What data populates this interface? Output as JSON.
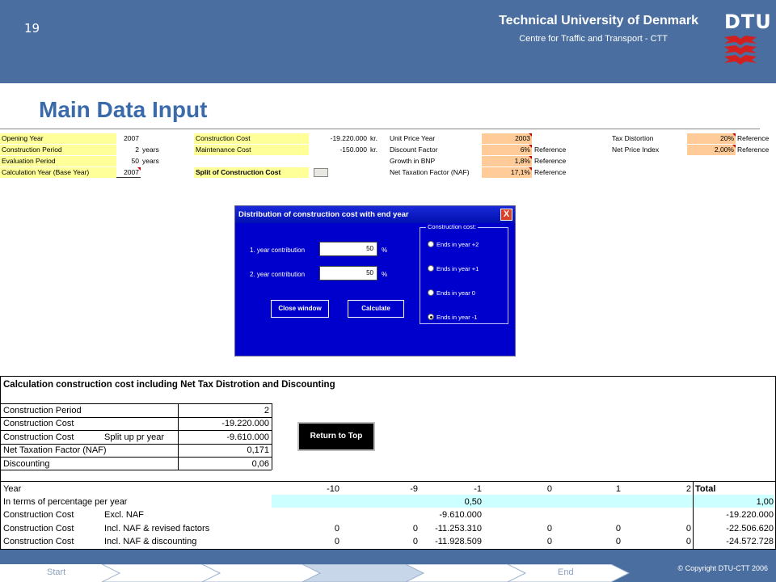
{
  "header": {
    "slide_number": "19",
    "university": "Technical University of Denmark",
    "centre": "Centre for Traffic and Transport - CTT",
    "logo_text": "DTU"
  },
  "page_title": "Main Data Input",
  "inputs": {
    "opening_year": {
      "label": "Opening Year",
      "value": "2007"
    },
    "construction_period": {
      "label": "Construction Period",
      "value": "2",
      "unit": "years"
    },
    "evaluation_period": {
      "label": "Evaluation Period",
      "value": "50",
      "unit": "years"
    },
    "calculation_year": {
      "label": "Calculation Year (Base Year)",
      "value": "2007"
    },
    "construction_cost": {
      "label": "Construction Cost",
      "value": "-19.220.000",
      "unit": "kr."
    },
    "maintenance_cost": {
      "label": "Maintenance Cost",
      "value": "-150.000",
      "unit": "kr."
    },
    "split_button_label": "Split of Construction Cost",
    "unit_price_year": {
      "label": "Unit Price Year",
      "value": "2003"
    },
    "discount_factor": {
      "label": "Discount Factor",
      "value": "6%",
      "ref": "Reference"
    },
    "growth_bnp": {
      "label": "Growth in BNP",
      "value": "1,8%",
      "ref": "Reference"
    },
    "naf": {
      "label": "Net Taxation Factor (NAF)",
      "value": "17,1%",
      "ref": "Reference"
    },
    "tax_distortion": {
      "label": "Tax Distortion",
      "value": "20%",
      "ref": "Reference"
    },
    "net_price_index": {
      "label": "Net Price Index",
      "value": "2,00%",
      "ref": "Reference"
    }
  },
  "dialog": {
    "title": "Distribution of construction cost with end year",
    "close": "X",
    "year1_label": "1. year contribution",
    "year1_value": "50",
    "year2_label": "2. year contribution",
    "year2_value": "50",
    "percent": "%",
    "close_button": "Close window",
    "calculate_button": "Calculate",
    "group_label": "Construction cost:",
    "options": [
      "Ends in year +2",
      "Ends in year +1",
      "Ends in year 0",
      "Ends in year -1"
    ],
    "selected_index": 3
  },
  "calc": {
    "title": "Calculation construction cost including Net Tax Distrotion and Discounting",
    "summary": [
      {
        "label": "Construction Period",
        "sub": "",
        "value": "2"
      },
      {
        "label": "Construction Cost",
        "sub": "",
        "value": "-19.220.000"
      },
      {
        "label": "Construction Cost",
        "sub": "Split up pr year",
        "value": "-9.610.000"
      },
      {
        "label": "Net Taxation Factor (NAF)",
        "sub": "",
        "value": "0,171"
      },
      {
        "label": "Discounting",
        "sub": "",
        "value": "0,06"
      }
    ],
    "return_button": "Return to Top",
    "year_row": {
      "label": "Year",
      "cols": [
        "-10",
        "-9",
        "-1",
        "0",
        "1",
        "2"
      ],
      "total_label": "Total"
    },
    "rows": [
      {
        "label": "In terms of percentage per year",
        "sub": "",
        "cols": [
          "",
          "",
          "0,50",
          "",
          "",
          ""
        ],
        "total": "1,00"
      },
      {
        "label": "Construction Cost",
        "sub": "Excl. NAF",
        "cols": [
          "",
          "",
          "-9.610.000",
          "",
          "",
          ""
        ],
        "total": "-19.220.000"
      },
      {
        "label": "Construction Cost",
        "sub": "Incl. NAF & revised factors",
        "cols": [
          "0",
          "0",
          "-11.253.310",
          "0",
          "0",
          "0"
        ],
        "total": "-22.506.620"
      },
      {
        "label": "Construction Cost",
        "sub": "Incl. NAF & discounting",
        "cols": [
          "0",
          "0",
          "-11.928.509",
          "0",
          "0",
          "0"
        ],
        "total": "-24.572.728"
      }
    ]
  },
  "footer": {
    "start": "Start",
    "end": "End",
    "copyright": "© Copyright DTU-CTT 2006"
  },
  "colors": {
    "header_bg": "#4a6ea0",
    "title": "#3a6aaa",
    "dialog_bg": "#0000cc",
    "input_yellow": "#ffff99",
    "input_orange": "#ffcc99",
    "cyan": "#ccffff"
  }
}
